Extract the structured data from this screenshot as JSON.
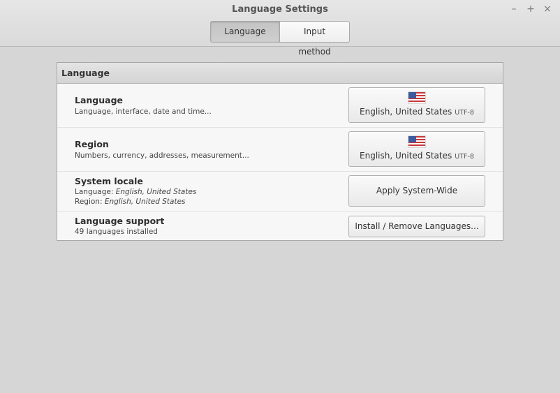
{
  "window": {
    "title": "Language Settings"
  },
  "tabs": [
    {
      "label": "Language",
      "active": true
    },
    {
      "label": "Input method",
      "active": false
    }
  ],
  "frame": {
    "header": "Language",
    "rows": [
      {
        "title": "Language",
        "subtitle": "Language, interface, date and time...",
        "button": {
          "flag": "us-flag-icon",
          "label": "English, United States",
          "encoding": "UTF-8"
        }
      },
      {
        "title": "Region",
        "subtitle": "Numbers, currency, addresses, measurement...",
        "button": {
          "flag": "us-flag-icon",
          "label": "English, United States",
          "encoding": "UTF-8"
        }
      },
      {
        "title": "System locale",
        "language_prefix": "Language: ",
        "language_value": "English, United States",
        "region_prefix": "Region: ",
        "region_value": "English, United States",
        "button": {
          "label": "Apply System-Wide"
        }
      },
      {
        "title": "Language support",
        "subtitle": "49 languages installed",
        "button": {
          "label": "Install / Remove Languages..."
        }
      }
    ]
  },
  "icons": {
    "minimize": "–",
    "maximize": "+",
    "close": "×"
  }
}
